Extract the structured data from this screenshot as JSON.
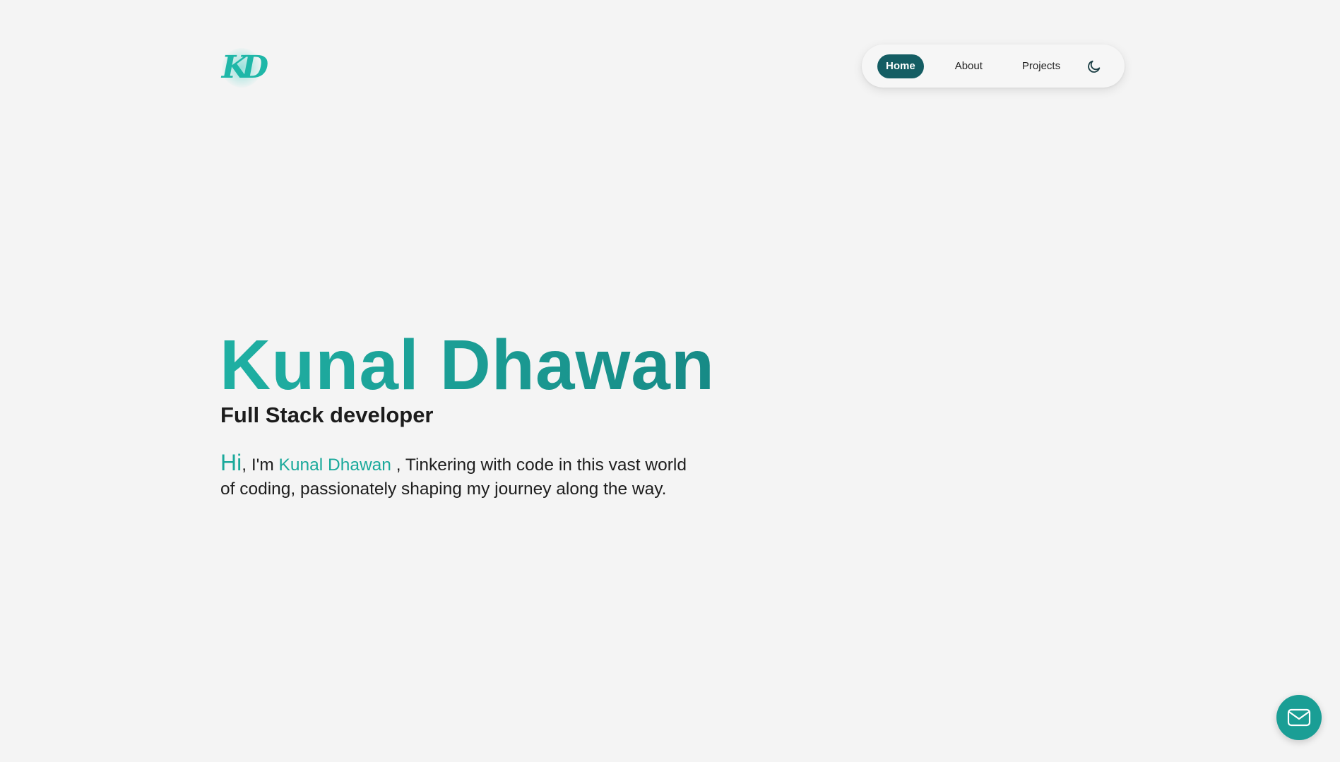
{
  "logo": {
    "text": "KD",
    "icon": "kd-monogram-logo"
  },
  "nav": {
    "items": [
      {
        "label": "Home",
        "active": true
      },
      {
        "label": "About",
        "active": false
      },
      {
        "label": "Projects",
        "active": false
      }
    ],
    "theme_toggle_icon": "moon-icon"
  },
  "hero": {
    "title": "Kunal Dhawan",
    "subtitle": "Full Stack developer",
    "intro": {
      "greeting": "Hi",
      "prefix": ", I'm ",
      "name": "Kunal Dhawan",
      "line1_rest": " , Tinkering with code in this vast world",
      "line2": "of coding, passionately shaping my journey along the way."
    }
  },
  "mail_button_icon": "mail-icon",
  "colors": {
    "accent": "#1aa99b",
    "nav_active_bg": "#145d63",
    "line": "#1b7f86",
    "background": "#f4f4f4"
  }
}
